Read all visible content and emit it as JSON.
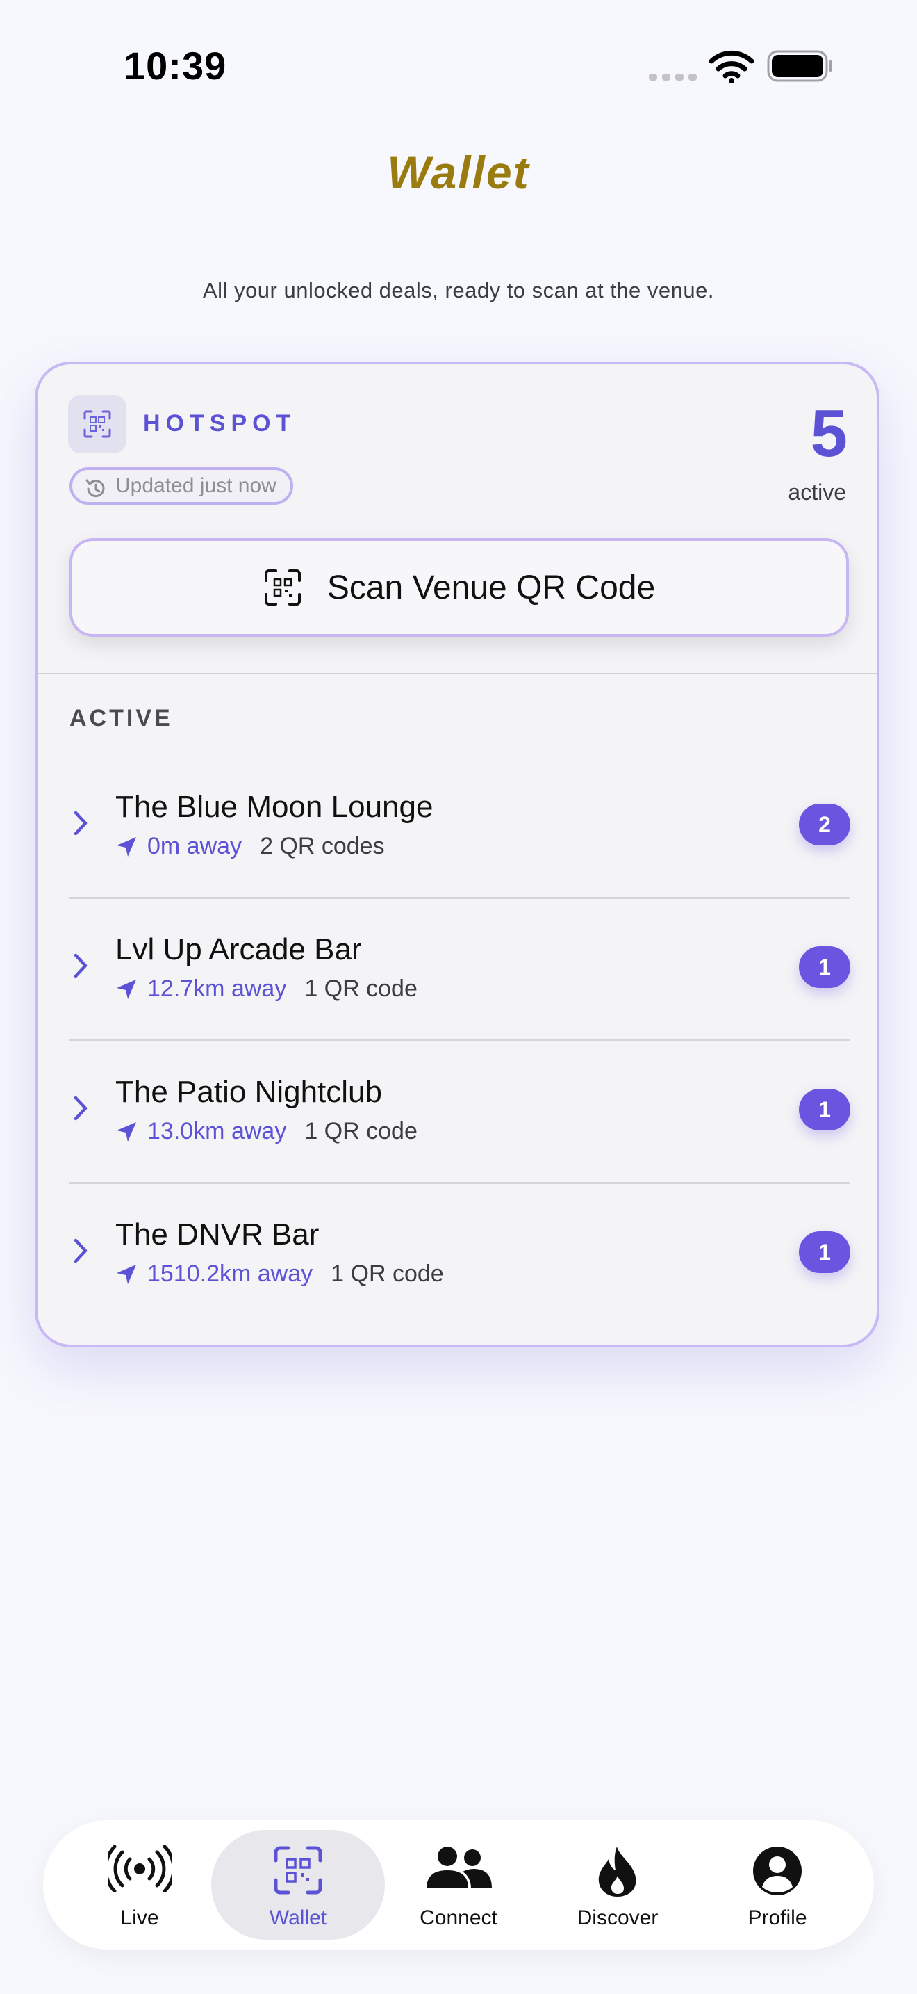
{
  "status_bar": {
    "time": "10:39"
  },
  "header": {
    "title": "Wallet",
    "subtitle": "All your unlocked deals, ready to scan at the venue."
  },
  "card": {
    "brand": "HOTSPOT",
    "updated": "Updated just now",
    "active_count": "5",
    "active_label": "active",
    "scan_button_label": "Scan Venue QR Code",
    "section_label": "ACTIVE",
    "venues": [
      {
        "name": "The Blue Moon Lounge",
        "distance": "0m away",
        "codes": "2 QR codes",
        "badge": "2"
      },
      {
        "name": "Lvl Up Arcade Bar",
        "distance": "12.7km away",
        "codes": "1 QR code",
        "badge": "1"
      },
      {
        "name": "The Patio Nightclub",
        "distance": "13.0km away",
        "codes": "1 QR code",
        "badge": "1"
      },
      {
        "name": "The DNVR Bar",
        "distance": "1510.2km away",
        "codes": "1 QR code",
        "badge": "1"
      }
    ]
  },
  "tab_bar": {
    "selected": "Wallet",
    "tabs": [
      {
        "label": "Live",
        "icon": "broadcast-icon"
      },
      {
        "label": "Wallet",
        "icon": "qr-code-icon"
      },
      {
        "label": "Connect",
        "icon": "people-icon"
      },
      {
        "label": "Discover",
        "icon": "flame-icon"
      },
      {
        "label": "Profile",
        "icon": "profile-icon"
      }
    ]
  },
  "colors": {
    "accent": "#5B52D6",
    "badge": "#6B55E0",
    "title": "#9A7B10",
    "background": "#F7F8FD",
    "card_border": "#C8B8F4"
  }
}
